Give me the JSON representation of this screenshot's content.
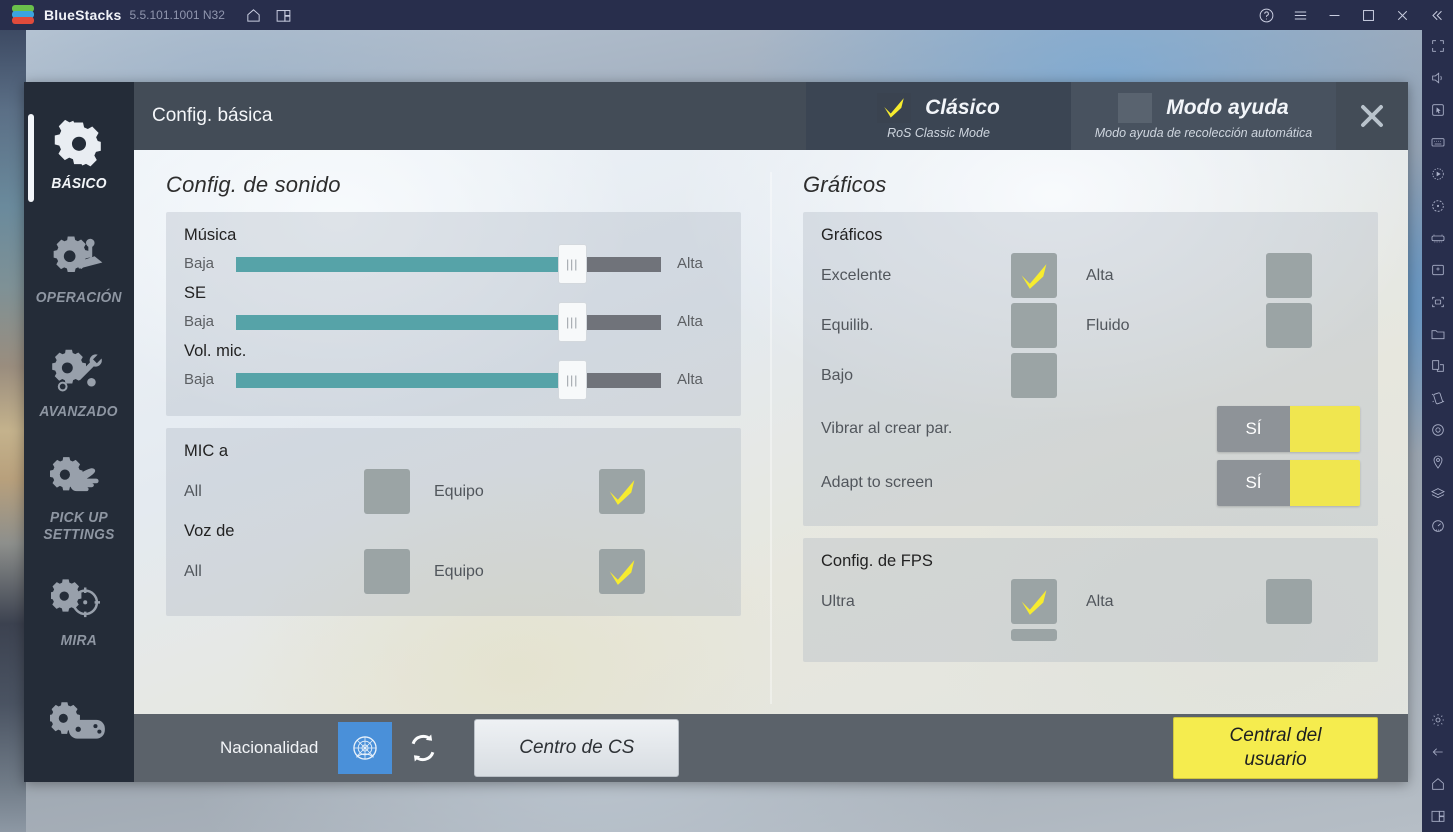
{
  "titlebar": {
    "app_name": "BlueStacks",
    "version": "5.5.101.1001 N32",
    "icons": [
      "home-icon",
      "multi-instance-icon"
    ],
    "right_icons": [
      "help-icon",
      "menu-icon",
      "minimize-icon",
      "maximize-icon",
      "close-icon",
      "collapse-icon"
    ]
  },
  "right_toolbar": {
    "icons": [
      "fullscreen-icon",
      "volume-icon",
      "cursor-icon",
      "keyboard-icon",
      "macro-icon",
      "rotate-icon",
      "gamepad-icon",
      "install-apk-icon",
      "screenshot-icon",
      "folder-icon",
      "multi-instance-icon",
      "shake-icon",
      "record-icon",
      "location-icon",
      "layers-icon",
      "performance-icon"
    ],
    "bottom_icons": [
      "settings-icon",
      "back-icon",
      "home-icon",
      "recents-icon"
    ]
  },
  "sidebar": {
    "items": [
      {
        "label": "BÁSICO",
        "icon": "gear-icon",
        "active": true
      },
      {
        "label": "OPERACIÓN",
        "icon": "gear-joystick-icon",
        "active": false
      },
      {
        "label": "AVANZADO",
        "icon": "gear-wrench-icon",
        "active": false
      },
      {
        "label": "PICK UP SETTINGS",
        "icon": "gear-hand-icon",
        "active": false
      },
      {
        "label": "MIRA",
        "icon": "gear-crosshair-icon",
        "active": false
      },
      {
        "label": "",
        "icon": "gear-gamepad-icon",
        "active": false
      }
    ]
  },
  "header": {
    "title": "Config. básica",
    "close_icon": "close-icon",
    "modes": [
      {
        "name": "Clásico",
        "subtitle": "RoS Classic Mode",
        "checked": true
      },
      {
        "name": "Modo ayuda",
        "subtitle": "Modo ayuda de recolección automática",
        "checked": false
      }
    ]
  },
  "sound": {
    "section_title": "Config. de sonido",
    "volume_card": {
      "title": "Música",
      "sliders": [
        {
          "label": "Música",
          "min_label": "Baja",
          "max_label": "Alta",
          "value": 79
        },
        {
          "label": "SE",
          "min_label": "Baja",
          "max_label": "Alta",
          "value": 79
        },
        {
          "label": "Vol. mic.",
          "min_label": "Baja",
          "max_label": "Alta",
          "value": 79
        }
      ]
    },
    "mic_card": {
      "groups": [
        {
          "title": "MIC a",
          "options": [
            {
              "label": "All",
              "checked": false
            },
            {
              "label": "Equipo",
              "checked": true
            }
          ]
        },
        {
          "title": "Voz de",
          "options": [
            {
              "label": "All",
              "checked": false
            },
            {
              "label": "Equipo",
              "checked": true
            }
          ]
        }
      ]
    }
  },
  "graphics": {
    "section_title": "Gráficos",
    "quality_card": {
      "title": "Gráficos",
      "rows": [
        {
          "left_label": "Excelente",
          "left_checked": true,
          "right_label": "Alta",
          "right_checked": false
        },
        {
          "left_label": "Equilib.",
          "left_checked": false,
          "right_label": "Fluido",
          "right_checked": false
        },
        {
          "left_label": "Bajo",
          "left_checked": false,
          "right_label": "",
          "right_checked": null
        }
      ],
      "toggles": [
        {
          "label": "Vibrar al crear par.",
          "state_label": "SÍ",
          "on": true
        },
        {
          "label": "Adapt to screen",
          "state_label": "SÍ",
          "on": true
        }
      ]
    },
    "fps_card": {
      "title": "Config. de FPS",
      "rows": [
        {
          "left_label": "Ultra",
          "left_checked": true,
          "right_label": "Alta",
          "right_checked": false
        }
      ]
    }
  },
  "footer": {
    "nationality_label": "Nacionalidad",
    "flag_icon": "un-flag-icon",
    "refresh_icon": "refresh-icon",
    "cs_button": "Centro de CS",
    "user_button_line1": "Central del",
    "user_button_line2": "usuario"
  },
  "colors": {
    "accent_yellow": "#f5ec4e",
    "slider_fill": "#56a3a8",
    "slider_track": "#70737a",
    "checkbox_bg": "#9ba4a5",
    "sidebar_bg": "#242c38",
    "header_bg": "#434c57",
    "footer_bg": "#5b626a",
    "titlebar_bg": "#282e4c"
  }
}
